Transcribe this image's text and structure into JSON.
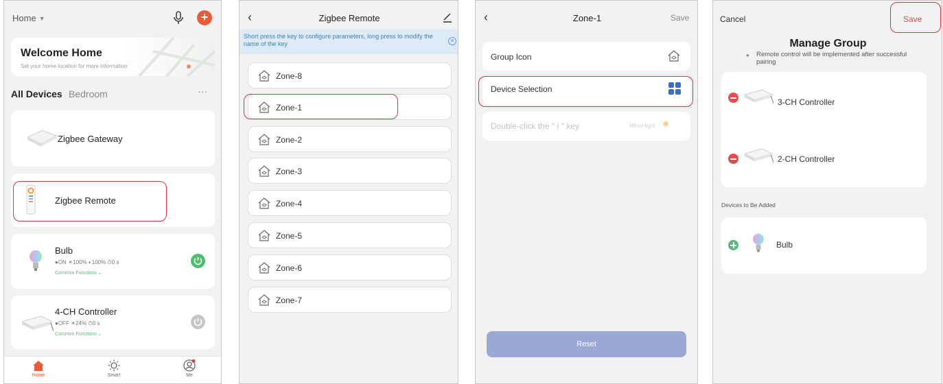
{
  "colors": {
    "accent": "#ee5a36",
    "highlight": "#d9343b",
    "green": "#4cbf6f",
    "power_off": "#c5c5c5",
    "banner_bg": "#dcebf7",
    "banner_text": "#3d7fc1",
    "reset_bg": "#9aa8d6",
    "remove": "#e94b4b",
    "add": "#53b97c"
  },
  "home": {
    "home_label": "Home",
    "welcome_title": "Welcome Home",
    "welcome_sub": "Set your home location for more information",
    "tabs": [
      "All Devices",
      "Bedroom"
    ],
    "more": "···",
    "devices": [
      {
        "name": "Zigbee Gateway",
        "icon": "gateway-icon"
      },
      {
        "name": "Zigbee Remote",
        "icon": "remote-icon"
      },
      {
        "name": "Bulb",
        "icon": "bulb-icon",
        "status": "●ON ☀100% ◐100% ⏱0 s",
        "functions": "Common Functions ⌄"
      },
      {
        "name": "4-CH Controller",
        "icon": "controller-icon",
        "status": "●OFF ☀24% ⏱0 s",
        "functions": "Common Functions ⌄"
      }
    ],
    "nav": [
      "Home",
      "Smart",
      "Me"
    ]
  },
  "remote": {
    "title": "Zigbee Remote",
    "banner": "Short press the key to configure parameters, long press to modify the name of the key",
    "zones": [
      "Zone-8",
      "Zone-1",
      "Zone-2",
      "Zone-3",
      "Zone-4",
      "Zone-5",
      "Zone-6",
      "Zone-7"
    ]
  },
  "zone": {
    "title": "Zone-1",
    "save": "Save",
    "group_icon": "Group Icon",
    "device_selection": "Device Selection",
    "double_click": "Double-click the \" I \" key",
    "white_light": "White light",
    "reset": "Reset"
  },
  "manage": {
    "cancel": "Cancel",
    "save": "Save",
    "title": "Manage Group",
    "note": "Remote control will be implemented after successful pairing",
    "group_devices": [
      "3-CH Controller",
      "2-CH Controller"
    ],
    "to_add_label": "Devices to Be Added",
    "to_add": [
      "Bulb"
    ]
  }
}
